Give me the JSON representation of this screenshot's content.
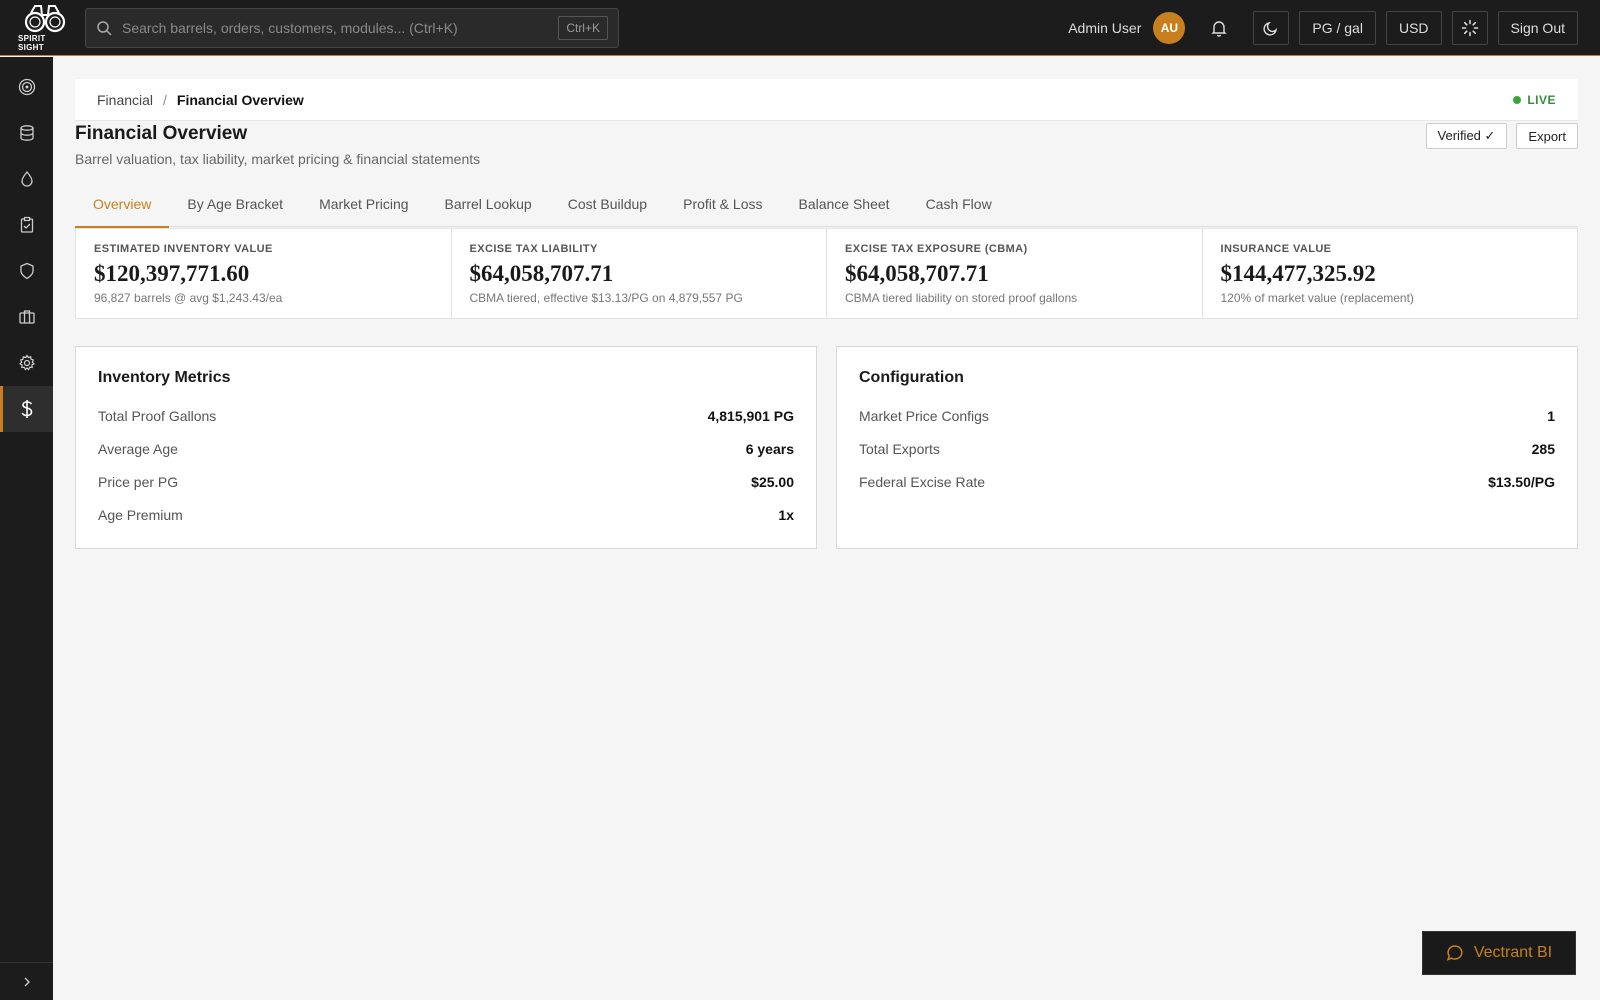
{
  "app": {
    "name": "SPIRIT SIGHT"
  },
  "search": {
    "placeholder": "Search barrels, orders, customers, modules... (Ctrl+K)",
    "shortcut": "Ctrl+K"
  },
  "user": {
    "name": "Admin User",
    "initials": "AU"
  },
  "toolbar": {
    "unit_label": "PG / gal",
    "currency_label": "USD",
    "signout_label": "Sign Out"
  },
  "sidebar": {
    "items": [
      {
        "icon": "target-icon"
      },
      {
        "icon": "database-icon"
      },
      {
        "icon": "droplet-icon"
      },
      {
        "icon": "clipboard-check-icon"
      },
      {
        "icon": "shield-icon"
      },
      {
        "icon": "briefcase-icon"
      },
      {
        "icon": "gear-icon"
      },
      {
        "icon": "dollar-icon",
        "active": true
      }
    ]
  },
  "breadcrumb": {
    "parent": "Financial",
    "separator": "/",
    "current": "Financial Overview"
  },
  "status": {
    "live": "LIVE"
  },
  "page": {
    "title": "Financial Overview",
    "subtitle": "Barrel valuation, tax liability, market pricing & financial statements",
    "verified_label": "Verified ✓",
    "export_label": "Export"
  },
  "tabs": [
    "Overview",
    "By Age Bracket",
    "Market Pricing",
    "Barrel Lookup",
    "Cost Buildup",
    "Profit & Loss",
    "Balance Sheet",
    "Cash Flow"
  ],
  "kpis": [
    {
      "label": "ESTIMATED INVENTORY VALUE",
      "value": "$120,397,771.60",
      "sub": "96,827 barrels @ avg $1,243.43/ea"
    },
    {
      "label": "EXCISE TAX LIABILITY",
      "value": "$64,058,707.71",
      "sub": "CBMA tiered, effective $13.13/PG on 4,879,557 PG"
    },
    {
      "label": "EXCISE TAX EXPOSURE (CBMA)",
      "value": "$64,058,707.71",
      "sub": "CBMA tiered liability on stored proof gallons"
    },
    {
      "label": "INSURANCE VALUE",
      "value": "$144,477,325.92",
      "sub": "120% of market value (replacement)"
    }
  ],
  "inventory_metrics": {
    "title": "Inventory Metrics",
    "rows": [
      {
        "label": "Total Proof Gallons",
        "value": "4,815,901 PG"
      },
      {
        "label": "Average Age",
        "value": "6 years"
      },
      {
        "label": "Price per PG",
        "value": "$25.00"
      },
      {
        "label": "Age Premium",
        "value": "1x"
      }
    ]
  },
  "configuration": {
    "title": "Configuration",
    "rows": [
      {
        "label": "Market Price Configs",
        "value": "1"
      },
      {
        "label": "Total Exports",
        "value": "285"
      },
      {
        "label": "Federal Excise Rate",
        "value": "$13.50/PG"
      }
    ]
  },
  "chat": {
    "label": "Vectrant BI"
  },
  "colors": {
    "accent": "#c8801f",
    "topbar": "#1c1c1c",
    "live": "#3aa63a"
  }
}
